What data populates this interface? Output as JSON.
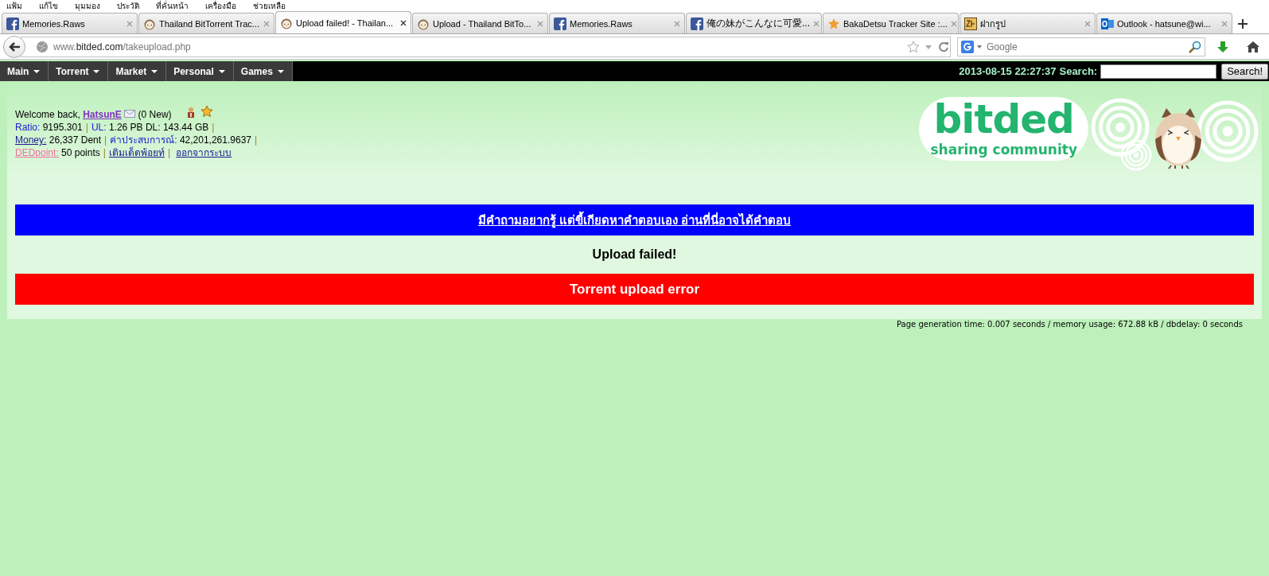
{
  "menu_bar": [
    "แฟ้ม",
    "แก้ไข",
    "มุมมอง",
    "ประวัติ",
    "ที่คั่นหน้า",
    "เครื่องมือ",
    "ช่วยเหลือ"
  ],
  "tabs": [
    {
      "title": "Memories.Raws",
      "kind": "facebook",
      "selected": false
    },
    {
      "title": "Thailand BitTorrent Trac...",
      "kind": "owl",
      "selected": false
    },
    {
      "title": "Upload failed! - Thailan...",
      "kind": "owl",
      "selected": true
    },
    {
      "title": "Upload - Thailand BitTo...",
      "kind": "owl",
      "selected": false
    },
    {
      "title": "Memories.Raws",
      "kind": "facebook",
      "selected": false
    },
    {
      "title": "俺の妹がこんなに可愛...",
      "kind": "facebook",
      "selected": false
    },
    {
      "title": "BakaDetsu Tracker Site :...",
      "kind": "star",
      "selected": false
    },
    {
      "title": "ฝากรูป",
      "kind": "frame",
      "selected": false
    },
    {
      "title": "Outlook - hatsune@wi...",
      "kind": "outlook",
      "selected": false
    }
  ],
  "address_bar": {
    "prefix": "www.",
    "domain": "bitded.com",
    "path": "/takeupload.php"
  },
  "browser_search": {
    "placeholder": "Google"
  },
  "site_nav": {
    "items": [
      "Main",
      "Torrent",
      "Market",
      "Personal",
      "Games"
    ],
    "datetime": "2013-08-15 22:27:37",
    "search_label": "Search:",
    "search_button": "Search!"
  },
  "user_info": {
    "welcome": "Welcome back,",
    "username": "HatsunE",
    "messages": "(0 New)",
    "ratio_label": "Ratio:",
    "ratio": "9195.301",
    "ul_label": "UL:",
    "ul": "1.26 PB",
    "dl_label": "DL:",
    "dl": "143.44 GB",
    "money_label": "Money:",
    "money": "26,337 Dent",
    "exp_label": "ค่าประสบการณ์:",
    "exp": "42,201,261.9637",
    "separator": "|",
    "point_label": "DEDpoint:",
    "points": "50 points",
    "topup_link": "เติมเด็ดพ้อยท์",
    "logout_link": "ออกจากระบบ"
  },
  "logo": {
    "name": "bitded",
    "tagline": "sharing community"
  },
  "faq_banner": "มีคำถามอยากรู้ แต่ขี้เกียดหาคำตอบเอง อ่านที่นี่อาจได้คำตอบ",
  "result_title": "Upload failed!",
  "error_banner": "Torrent upload error",
  "footer": "Page generation time: 0.007 seconds / memory usage: 672.88 kB / dbdelay: 0 seconds"
}
